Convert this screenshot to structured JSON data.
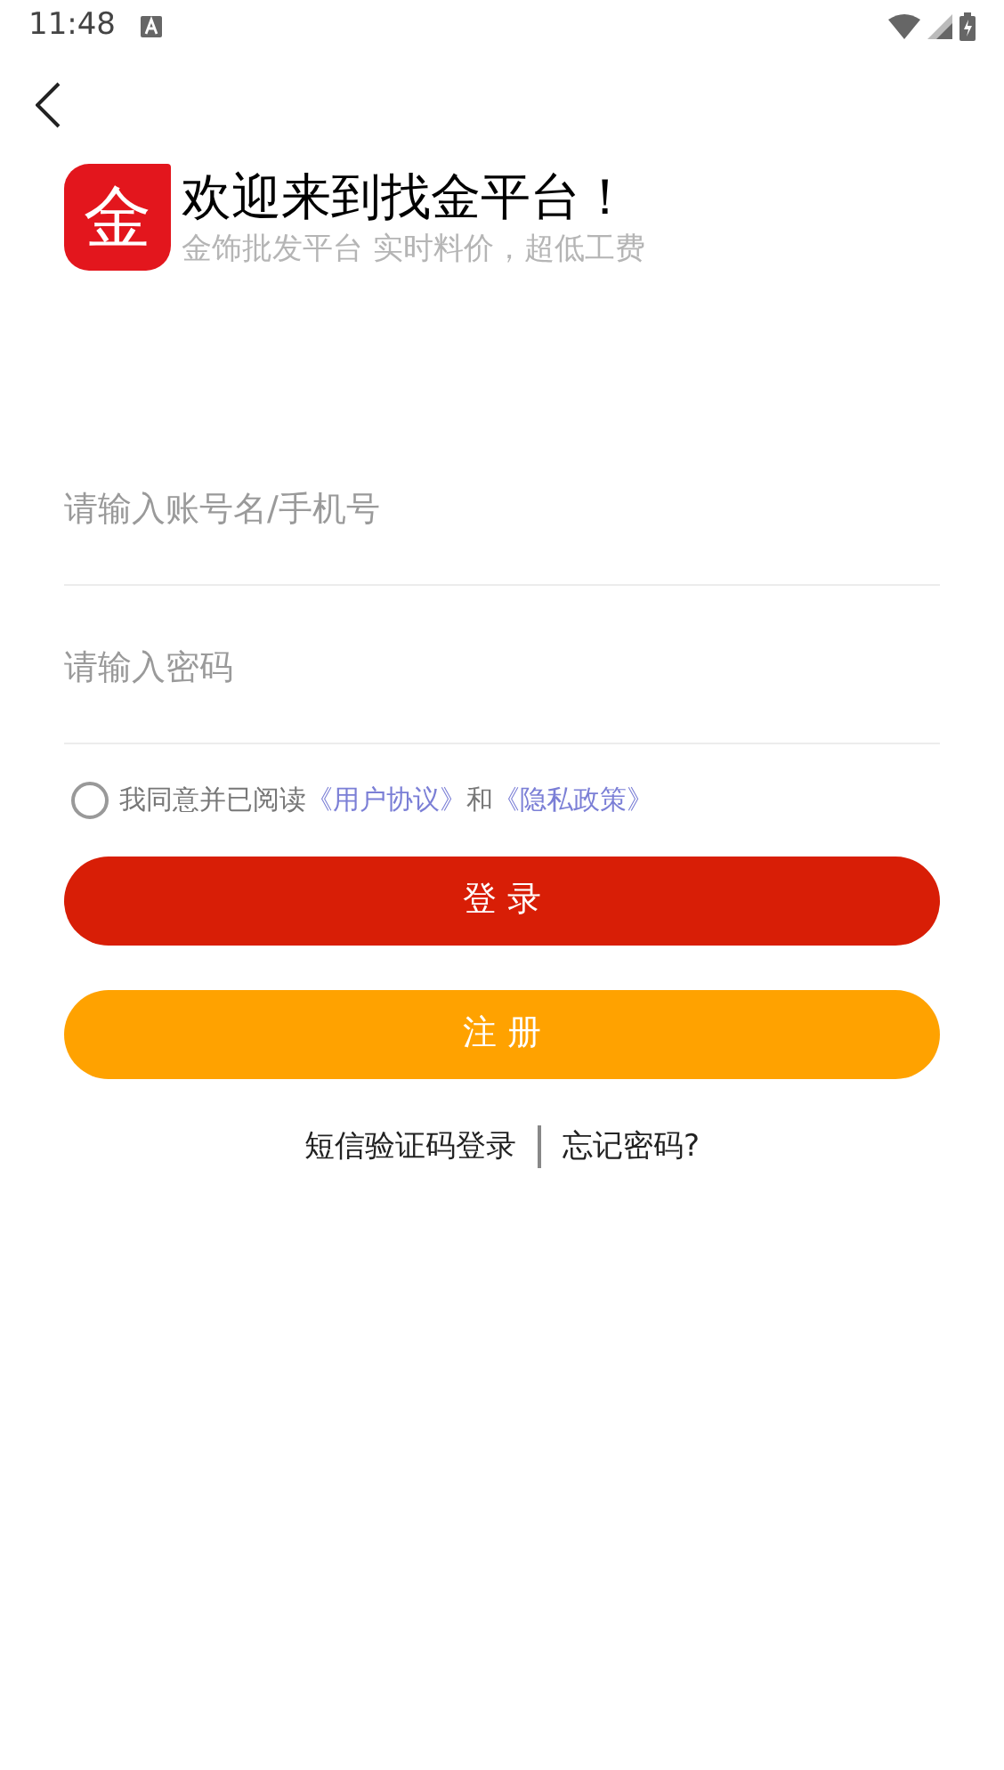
{
  "status_bar": {
    "time": "11:48"
  },
  "header": {
    "logo_text": "金",
    "title": "欢迎来到找金平台！",
    "subtitle": "金饰批发平台 实时料价，超低工费"
  },
  "fields": [
    {
      "placeholder": "请输入账号名/手机号"
    },
    {
      "placeholder": "请输入密码"
    }
  ],
  "agreement": {
    "checked": false,
    "text": "我同意并已阅读",
    "link_1": "《用户协议》",
    "joiner": "和",
    "link_2": "《隐私政策》"
  },
  "buttons": [
    {
      "label": "登 录",
      "kind": "primary"
    },
    {
      "label": "注 册",
      "kind": "secondary"
    }
  ],
  "links": [
    "短信验证码登录",
    "忘记密码?"
  ]
}
